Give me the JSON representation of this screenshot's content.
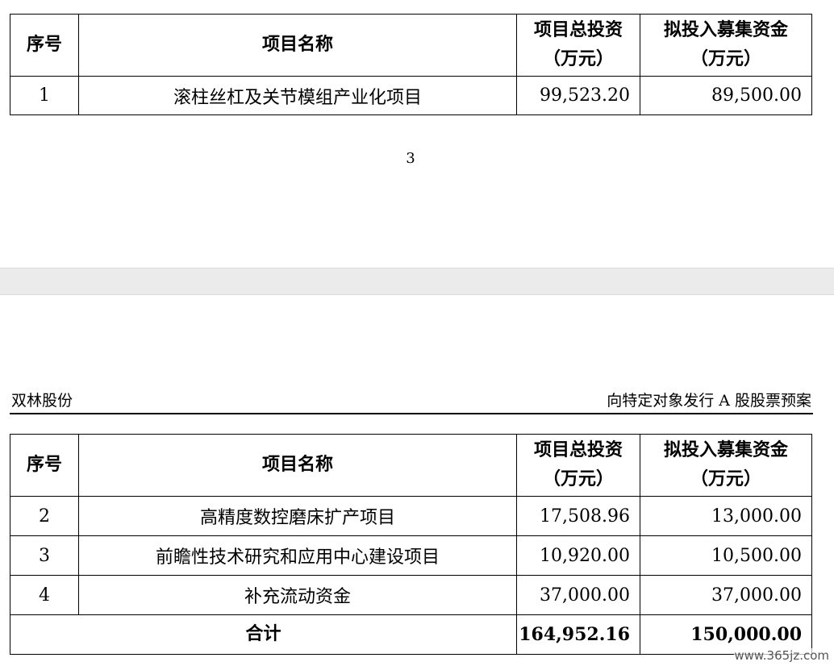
{
  "header": {
    "left": "双林股份",
    "right": "向特定对象发行 A 股股票预案"
  },
  "table_headers": {
    "no": "序号",
    "name": "项目名称",
    "total_line1": "项目总投资",
    "total_line2": "（万元）",
    "raise_line1": "拟投入募集资金",
    "raise_line2": "（万元）"
  },
  "page1_rows": [
    {
      "no": "1",
      "name": "滚柱丝杠及关节模组产业化项目",
      "total": "99,523.20",
      "raise": "89,500.00"
    }
  ],
  "page_number": "3",
  "page2_rows": [
    {
      "no": "2",
      "name": "高精度数控磨床扩产项目",
      "total": "17,508.96",
      "raise": "13,000.00"
    },
    {
      "no": "3",
      "name": "前瞻性技术研究和应用中心建设项目",
      "total": "10,920.00",
      "raise": "10,500.00"
    },
    {
      "no": "4",
      "name": "补充流动资金",
      "total": "37,000.00",
      "raise": "37,000.00"
    }
  ],
  "total_row": {
    "label": "合计",
    "total": "164,952.16",
    "raise": "150,000.00"
  },
  "watermark": "www.365jz.com"
}
